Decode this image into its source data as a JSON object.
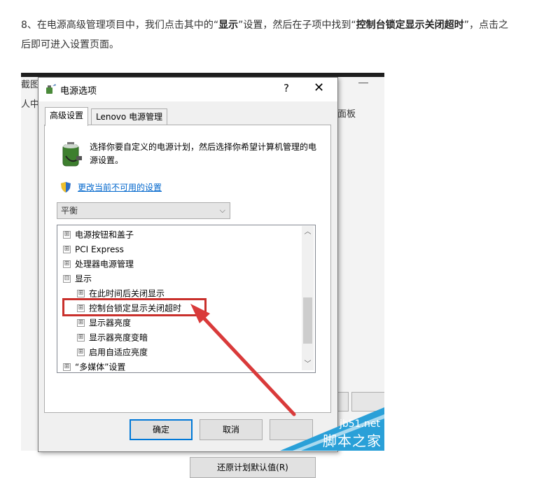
{
  "article": {
    "p1": "8、在电源高级管理项目中，我们点击其中的“",
    "b1": "显示",
    "p2": "”设置，然后在子项中找到“",
    "b2": "控制台锁定显示关闭超时",
    "p3": "”，点击之后即可进入设置页面。"
  },
  "background_window": {
    "frag_top": "截图",
    "frag_left": "人中",
    "frag_right": "面板"
  },
  "dialog": {
    "title": "电源选项",
    "help_glyph": "?",
    "close_glyph": "✕",
    "tabs": [
      "高级设置",
      "Lenovo 电源管理"
    ],
    "description": "选择你要自定义的电源计划，然后选择你希望计算机管理的电源设置。",
    "change_link": "更改当前不可用的设置",
    "plan_select": {
      "value": "平衡",
      "arrow": "⌵"
    },
    "tree_items": [
      {
        "expander": "⊞",
        "label": "电源按钮和盖子"
      },
      {
        "expander": "⊞",
        "label": "PCI Express"
      },
      {
        "expander": "⊞",
        "label": "处理器电源管理"
      },
      {
        "expander": "⊟",
        "label": "显示"
      },
      {
        "expander": "⊞",
        "label": "在此时间后关闭显示"
      },
      {
        "expander": "⊞",
        "label": "控制台锁定显示关闭超时"
      },
      {
        "expander": "⊞",
        "label": "显示器亮度"
      },
      {
        "expander": "⊞",
        "label": "显示器亮度变暗"
      },
      {
        "expander": "⊞",
        "label": "启用自适应亮度"
      },
      {
        "expander": "⊞",
        "label": "“多媒体”设置"
      }
    ],
    "scroll_up": "︿",
    "scroll_down": "﹀",
    "restore_button": "还原计划默认值(R)",
    "ok_button": "确定",
    "cancel_button": "取消"
  },
  "watermark": {
    "site": "jb51.net",
    "name": "脚本之家"
  },
  "colors": {
    "highlight": "#c9302c",
    "link": "#0066cc",
    "watermark": "#2aa0d8"
  }
}
